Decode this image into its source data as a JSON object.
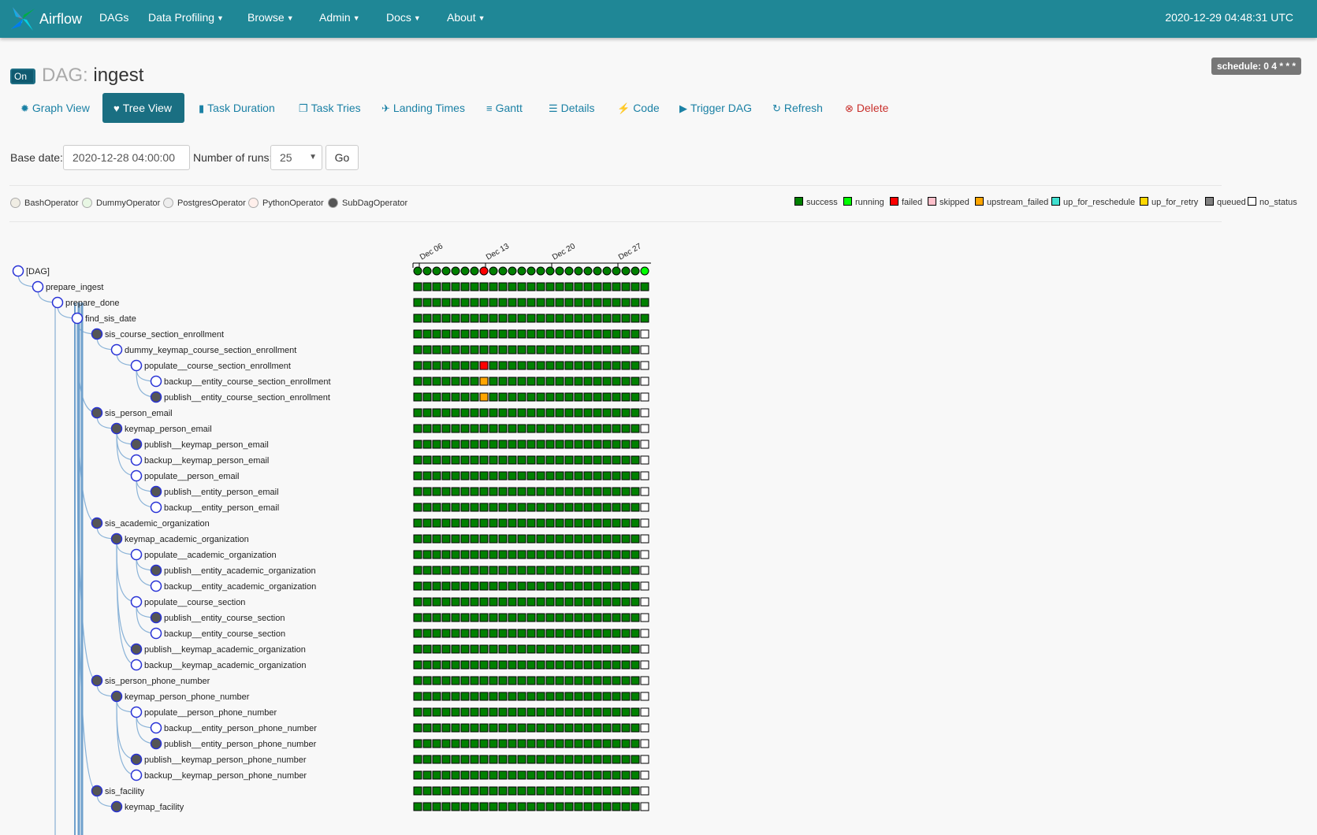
{
  "navbar": {
    "brand": "Airflow",
    "items": [
      "DAGs",
      "Data Profiling",
      "Browse",
      "Admin",
      "Docs",
      "About"
    ],
    "clock": "2020-12-29 04:48:31 UTC"
  },
  "dag": {
    "toggle_label": "On",
    "title_prefix": "DAG:",
    "name": "ingest",
    "schedule": "schedule: 0 4 * * *"
  },
  "tabs": [
    {
      "label": "Graph View",
      "icon": "graph-icon"
    },
    {
      "label": "Tree View",
      "icon": "tree-icon"
    },
    {
      "label": "Task Duration",
      "icon": "bar-chart-icon"
    },
    {
      "label": "Task Tries",
      "icon": "duplicate-icon"
    },
    {
      "label": "Landing Times",
      "icon": "plane-icon"
    },
    {
      "label": "Gantt",
      "icon": "align-left-icon"
    },
    {
      "label": "Details",
      "icon": "list-icon"
    },
    {
      "label": "Code",
      "icon": "flash-icon"
    },
    {
      "label": "Trigger DAG",
      "icon": "play-circle-icon"
    },
    {
      "label": "Refresh",
      "icon": "refresh-icon"
    },
    {
      "label": "Delete",
      "icon": "remove-circle-icon"
    }
  ],
  "form": {
    "base_date_label": "Base date:",
    "base_date_value": "2020-12-28 04:00:00",
    "runs_label": "Number of runs:",
    "runs_value": "25",
    "go_label": "Go"
  },
  "operators": [
    {
      "name": "BashOperator",
      "color": "#f0ede4"
    },
    {
      "name": "DummyOperator",
      "color": "#e8f7e4"
    },
    {
      "name": "PostgresOperator",
      "color": "#ededed"
    },
    {
      "name": "PythonOperator",
      "color": "#ffefeb"
    },
    {
      "name": "SubDagOperator",
      "color": "#555555"
    }
  ],
  "states": [
    {
      "name": "success",
      "color": "#008000"
    },
    {
      "name": "running",
      "color": "#00ff00"
    },
    {
      "name": "failed",
      "color": "#ff0000"
    },
    {
      "name": "skipped",
      "color": "#ffc0cb"
    },
    {
      "name": "upstream_failed",
      "color": "#ffa500"
    },
    {
      "name": "up_for_reschedule",
      "color": "#40e0d0"
    },
    {
      "name": "up_for_retry",
      "color": "#ffd700"
    },
    {
      "name": "queued",
      "color": "#808080"
    },
    {
      "name": "no_status",
      "color": "#ffffff"
    }
  ],
  "timeline": {
    "date_labels": [
      "Dec 06",
      "Dec 13",
      "Dec 20",
      "Dec 27"
    ]
  },
  "tasks": [
    {
      "label": "[DAG]",
      "depth": 0,
      "subdag": false
    },
    {
      "label": "prepare_ingest",
      "depth": 1,
      "subdag": false
    },
    {
      "label": "prepare_done",
      "depth": 2,
      "subdag": false
    },
    {
      "label": "find_sis_date",
      "depth": 3,
      "subdag": false
    },
    {
      "label": "sis_course_section_enrollment",
      "depth": 4,
      "subdag": true
    },
    {
      "label": "dummy_keymap_course_section_enrollment",
      "depth": 5,
      "subdag": false
    },
    {
      "label": "populate__course_section_enrollment",
      "depth": 6,
      "subdag": false
    },
    {
      "label": "backup__entity_course_section_enrollment",
      "depth": 7,
      "subdag": false
    },
    {
      "label": "publish__entity_course_section_enrollment",
      "depth": 7,
      "subdag": true
    },
    {
      "label": "sis_person_email",
      "depth": 4,
      "subdag": true
    },
    {
      "label": "keymap_person_email",
      "depth": 5,
      "subdag": true
    },
    {
      "label": "publish__keymap_person_email",
      "depth": 6,
      "subdag": true
    },
    {
      "label": "backup__keymap_person_email",
      "depth": 6,
      "subdag": false
    },
    {
      "label": "populate__person_email",
      "depth": 6,
      "subdag": false
    },
    {
      "label": "publish__entity_person_email",
      "depth": 7,
      "subdag": true
    },
    {
      "label": "backup__entity_person_email",
      "depth": 7,
      "subdag": false
    },
    {
      "label": "sis_academic_organization",
      "depth": 4,
      "subdag": true
    },
    {
      "label": "keymap_academic_organization",
      "depth": 5,
      "subdag": true
    },
    {
      "label": "populate__academic_organization",
      "depth": 6,
      "subdag": false
    },
    {
      "label": "publish__entity_academic_organization",
      "depth": 7,
      "subdag": true
    },
    {
      "label": "backup__entity_academic_organization",
      "depth": 7,
      "subdag": false
    },
    {
      "label": "populate__course_section",
      "depth": 6,
      "subdag": false
    },
    {
      "label": "publish__entity_course_section",
      "depth": 7,
      "subdag": true
    },
    {
      "label": "backup__entity_course_section",
      "depth": 7,
      "subdag": false
    },
    {
      "label": "publish__keymap_academic_organization",
      "depth": 6,
      "subdag": true
    },
    {
      "label": "backup__keymap_academic_organization",
      "depth": 6,
      "subdag": false
    },
    {
      "label": "sis_person_phone_number",
      "depth": 4,
      "subdag": true
    },
    {
      "label": "keymap_person_phone_number",
      "depth": 5,
      "subdag": true
    },
    {
      "label": "populate__person_phone_number",
      "depth": 6,
      "subdag": false
    },
    {
      "label": "backup__entity_person_phone_number",
      "depth": 7,
      "subdag": false
    },
    {
      "label": "publish__entity_person_phone_number",
      "depth": 7,
      "subdag": true
    },
    {
      "label": "publish__keymap_person_phone_number",
      "depth": 6,
      "subdag": true
    },
    {
      "label": "backup__keymap_person_phone_number",
      "depth": 6,
      "subdag": false
    },
    {
      "label": "sis_facility",
      "depth": 4,
      "subdag": true
    },
    {
      "label": "keymap_facility",
      "depth": 5,
      "subdag": true
    }
  ],
  "grid": {
    "runs": 25,
    "dag_run_states": [
      "success",
      "success",
      "success",
      "success",
      "success",
      "success",
      "success",
      "failed",
      "success",
      "success",
      "success",
      "success",
      "success",
      "success",
      "success",
      "success",
      "success",
      "success",
      "success",
      "success",
      "success",
      "success",
      "success",
      "success",
      "running"
    ],
    "row_rule": "all success except last column no_status from row 4 onward; rows 1-3 last column success",
    "exceptions": [
      {
        "row": 6,
        "run": 7,
        "state": "failed"
      },
      {
        "row": 7,
        "run": 7,
        "state": "upstream_failed"
      },
      {
        "row": 8,
        "run": 7,
        "state": "upstream_failed"
      }
    ]
  }
}
